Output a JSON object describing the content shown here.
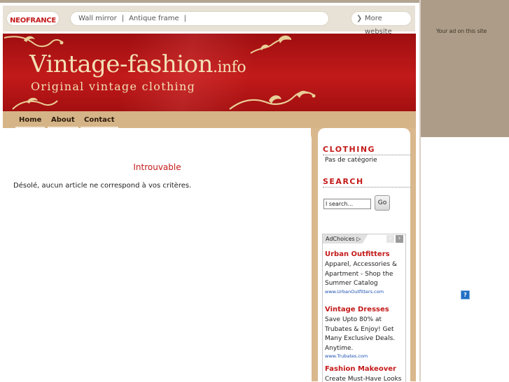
{
  "topbar": {
    "logo": "NEOFRANCE",
    "links": [
      "Wall mirror",
      "Antique frame"
    ],
    "separator": "|",
    "more": "More website"
  },
  "banner": {
    "title_main": "Vintage-fashion",
    "title_ext": ".info",
    "subtitle": "Original vintage clothing"
  },
  "nav": [
    "Home",
    "About",
    "Contact"
  ],
  "main": {
    "title": "Introuvable",
    "message": "Désolé, aucun article ne correspond à vos critères."
  },
  "sidebar": {
    "clothing_heading": "CLOTHING",
    "category_text": "Pas de catégorie",
    "search_heading": "SEARCH",
    "search_value": "I search...",
    "search_button": "Go"
  },
  "ads": {
    "adchoices": "AdChoices",
    "items": [
      {
        "title": "Urban Outfitters",
        "body": "Apparel, Accessories & Apartment - Shop the Summer Catalog",
        "url": "www.UrbanOutfitters.com"
      },
      {
        "title": "Vintage Dresses",
        "body": "Save Upto 80% at Trubates & Enjoy! Get Many Exclusive Deals. Anytime.",
        "url": "www.Trubates.com"
      },
      {
        "title": "Fashion Makeover",
        "body": "Create Must-Have Looks",
        "url": ""
      }
    ]
  },
  "right_panel": {
    "ad_text": "Your ad on this site",
    "help_icon": "?"
  },
  "colors": {
    "accent_red": "#c41a1a",
    "tan": "#d9b88d",
    "banner_red": "#b3161a",
    "right_panel": "#ad9d88",
    "ad_url_blue": "#1a4fb0"
  }
}
